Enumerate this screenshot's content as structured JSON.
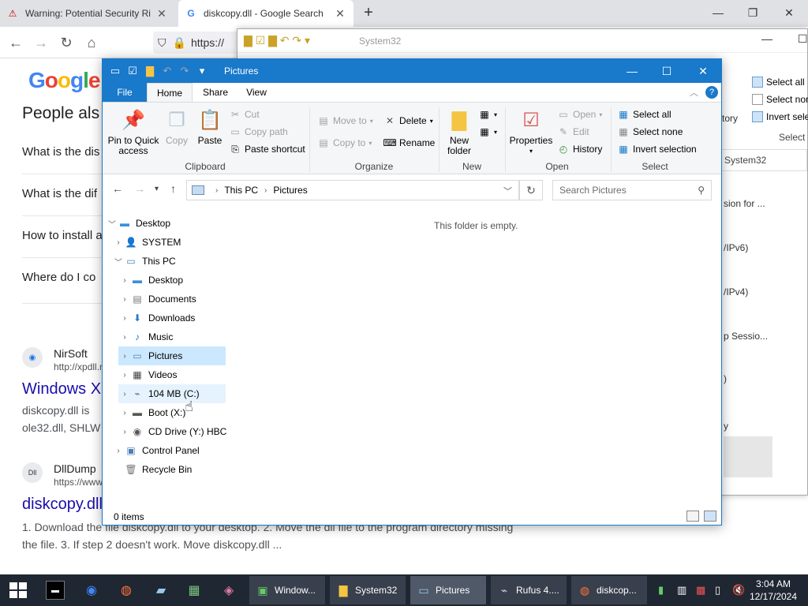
{
  "browser": {
    "tabs": [
      {
        "label": "Warning: Potential Security Ri",
        "close": "✕"
      },
      {
        "label": "diskcopy.dll - Google Search",
        "close": "✕"
      }
    ],
    "new_tab": "+",
    "url_prefix": "https://",
    "page": {
      "logo": "Google",
      "people_also": "People als",
      "questions": [
        "What is the dis",
        "What is the dif",
        "How to install a",
        "Where do I co"
      ],
      "results": [
        {
          "site": "NirSoft",
          "url": "http://xpdll.n",
          "title": "Windows X",
          "snippet1": "diskcopy.dll is",
          "snippet2": "ole32.dll, SHLW"
        },
        {
          "site": "DllDump",
          "url": "https://www",
          "title": "diskcopy.dll",
          "snippet1": "1. Download the file diskcopy.dll to your desktop. 2. Move the dll file to the program directory missing",
          "snippet2": "the file. 3. If step 2 doesn't work. Move diskcopy.dll ..."
        }
      ]
    }
  },
  "system32": {
    "title": "System32",
    "address": "System32",
    "select": [
      "Select all",
      "Select non",
      "Invert sele"
    ],
    "select_group": "Select",
    "history_frag": "tory",
    "rows": [
      "sion for ...",
      "/IPv6)",
      "/IPv4)",
      "p Sessio...",
      ")",
      "y"
    ]
  },
  "explorer": {
    "title": "Pictures",
    "ribbon_tabs": {
      "file": "File",
      "home": "Home",
      "share": "Share",
      "view": "View"
    },
    "clipboard": {
      "pin": "Pin to Quick access",
      "copy": "Copy",
      "paste": "Paste",
      "cut": "Cut",
      "copy_path": "Copy path",
      "paste_shortcut": "Paste shortcut",
      "label": "Clipboard"
    },
    "organize": {
      "move_to": "Move to",
      "copy_to": "Copy to",
      "delete": "Delete",
      "rename": "Rename",
      "label": "Organize"
    },
    "new": {
      "new_folder": "New folder",
      "label": "New"
    },
    "open": {
      "properties": "Properties",
      "open": "Open",
      "edit": "Edit",
      "history": "History",
      "label": "Open"
    },
    "select": {
      "select_all": "Select all",
      "select_none": "Select none",
      "invert": "Invert selection",
      "label": "Select"
    },
    "address": {
      "root": "This PC",
      "folder": "Pictures"
    },
    "search_placeholder": "Search Pictures",
    "tree": [
      {
        "label": "Desktop"
      },
      {
        "label": "SYSTEM"
      },
      {
        "label": "This PC"
      },
      {
        "label": "Desktop"
      },
      {
        "label": "Documents"
      },
      {
        "label": "Downloads"
      },
      {
        "label": "Music"
      },
      {
        "label": "Pictures"
      },
      {
        "label": "Videos"
      },
      {
        "label": "104 MB (C:)"
      },
      {
        "label": "Boot (X:)"
      },
      {
        "label": "CD Drive (Y:) HBC"
      },
      {
        "label": "Control Panel"
      },
      {
        "label": "Recycle Bin"
      }
    ],
    "empty_message": "This folder is empty.",
    "status": "0 items"
  },
  "taskbar": {
    "tasks": [
      {
        "label": "Window..."
      },
      {
        "label": "System32"
      },
      {
        "label": "Pictures"
      },
      {
        "label": "Rufus 4...."
      },
      {
        "label": "diskcop..."
      }
    ],
    "time": "3:04 AM",
    "date": "12/17/2024"
  },
  "colors": {
    "explorer_accent": "#1979ca",
    "taskbar_bg": "#1f2733",
    "selection": "#cce8ff",
    "link": "#1a0dab"
  }
}
